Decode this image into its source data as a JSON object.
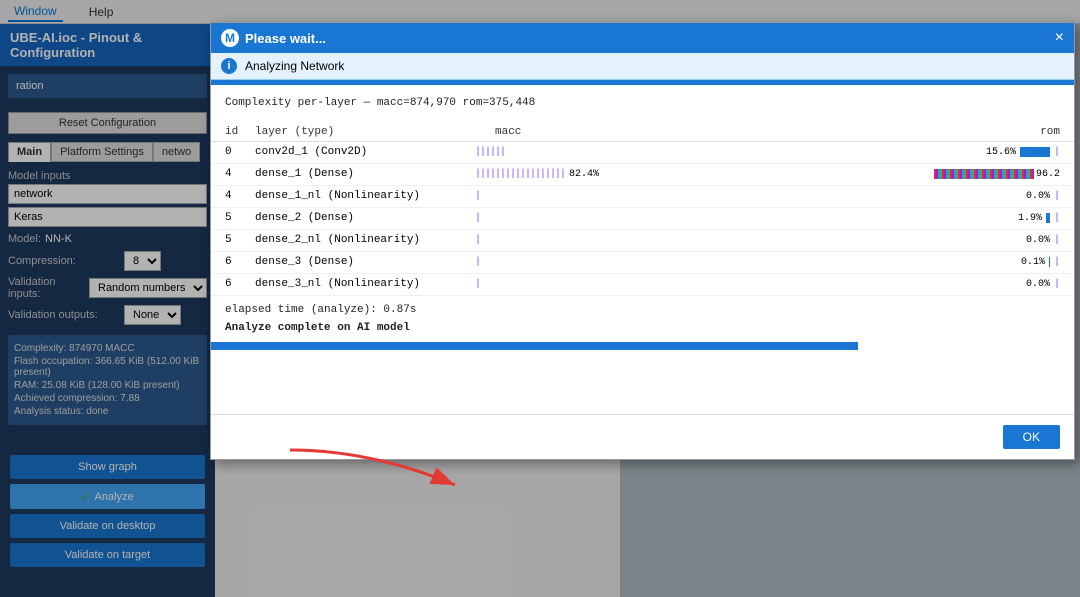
{
  "menubar": {
    "items": [
      "Window",
      "Help"
    ]
  },
  "sidebar": {
    "title": "UBE-AI.ioc - Pinout & Configuration",
    "section": "ration",
    "reset_button": "Reset Configuration",
    "tabs": [
      "Main",
      "Platform Settings",
      "netwo"
    ],
    "model_inputs_label": "Model inputs",
    "network_value": "network",
    "keras_value": "Keras",
    "model_label": "Model:",
    "model_value": "NN-K",
    "compression_label": "Compression:",
    "compression_value": "8",
    "validation_inputs_label": "Validation inputs:",
    "validation_inputs_value": "Random numbers",
    "validation_outputs_label": "Validation outputs:",
    "validation_outputs_value": "None",
    "stats": {
      "complexity": "Complexity: 874970 MACC",
      "flash": "Flash occupation: 366.65 KiB (512.00 KiB present)",
      "ram": "RAM: 25.08 KiB (128.00 KiB present)",
      "compression": "Achieved compression: 7.88",
      "status": "Analysis status: done"
    },
    "buttons": {
      "show_graph": "Show graph",
      "analyze": "Analyze",
      "validate_desktop": "Validate on desktop",
      "validate_target": "Validate on target"
    }
  },
  "modal": {
    "title": "Please wait...",
    "subheader": "Analyzing Network",
    "close_label": "×",
    "complexity_line": "Complexity per-layer — macc=874,970  rom=375,448",
    "table_headers": {
      "id": "id",
      "layer": "layer  (type)",
      "macc": "macc",
      "rom": "rom"
    },
    "rows": [
      {
        "id": "0",
        "layer": "conv2d_1   (Conv2D)",
        "macc_bar": 3,
        "macc_pct": "",
        "rom_pct": "15.6%",
        "rom_bar": 30
      },
      {
        "id": "4",
        "layer": "dense_1    (Dense)",
        "macc_bar": 100,
        "macc_pct": "82.4%",
        "rom_pct": "96.2",
        "rom_bar": 100
      },
      {
        "id": "4",
        "layer": "dense_1_nl (Nonlinearity)",
        "macc_bar": 1,
        "macc_pct": "",
        "rom_pct": "0.0%",
        "rom_bar": 0
      },
      {
        "id": "5",
        "layer": "dense_2    (Dense)",
        "macc_bar": 2,
        "macc_pct": "",
        "rom_pct": "1.9%",
        "rom_bar": 4
      },
      {
        "id": "5",
        "layer": "dense_2_nl (Nonlinearity)",
        "macc_bar": 1,
        "macc_pct": "",
        "rom_pct": "0.0%",
        "rom_bar": 0
      },
      {
        "id": "6",
        "layer": "dense_3    (Dense)",
        "macc_bar": 1,
        "macc_pct": "",
        "rom_pct": "0.1%",
        "rom_bar": 1
      },
      {
        "id": "6",
        "layer": "dense_3_nl (Nonlinearity)",
        "macc_bar": 1,
        "macc_pct": "",
        "rom_pct": "0.0%",
        "rom_bar": 0
      }
    ],
    "elapsed": "elapsed time (analyze): 0.87s",
    "complete": "Analyze complete on AI model",
    "ok_button": "OK"
  }
}
